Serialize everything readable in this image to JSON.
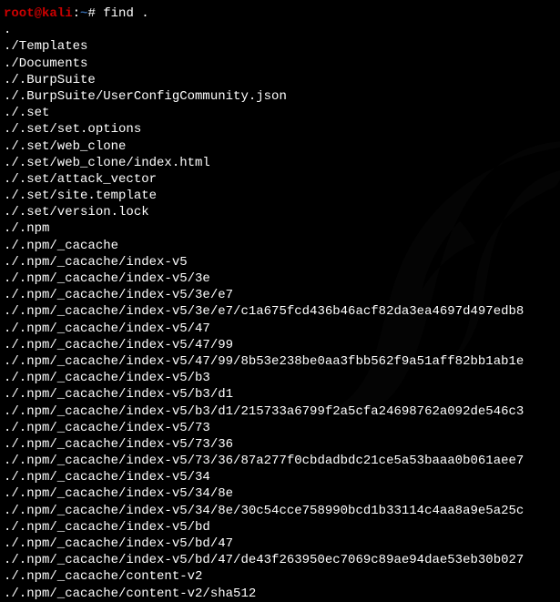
{
  "prompt": {
    "user": "root@kali",
    "separator": ":",
    "path": "~",
    "symbol": "#",
    "command": "find ."
  },
  "output": [
    ".",
    "./Templates",
    "./Documents",
    "./.BurpSuite",
    "./.BurpSuite/UserConfigCommunity.json",
    "./.set",
    "./.set/set.options",
    "./.set/web_clone",
    "./.set/web_clone/index.html",
    "./.set/attack_vector",
    "./.set/site.template",
    "./.set/version.lock",
    "./.npm",
    "./.npm/_cacache",
    "./.npm/_cacache/index-v5",
    "./.npm/_cacache/index-v5/3e",
    "./.npm/_cacache/index-v5/3e/e7",
    "./.npm/_cacache/index-v5/3e/e7/c1a675fcd436b46acf82da3ea4697d497edb8",
    "./.npm/_cacache/index-v5/47",
    "./.npm/_cacache/index-v5/47/99",
    "./.npm/_cacache/index-v5/47/99/8b53e238be0aa3fbb562f9a51aff82bb1ab1e",
    "./.npm/_cacache/index-v5/b3",
    "./.npm/_cacache/index-v5/b3/d1",
    "./.npm/_cacache/index-v5/b3/d1/215733a6799f2a5cfa24698762a092de546c3",
    "./.npm/_cacache/index-v5/73",
    "./.npm/_cacache/index-v5/73/36",
    "./.npm/_cacache/index-v5/73/36/87a277f0cbdadbdc21ce5a53baaa0b061aee7",
    "./.npm/_cacache/index-v5/34",
    "./.npm/_cacache/index-v5/34/8e",
    "./.npm/_cacache/index-v5/34/8e/30c54cce758990bcd1b33114c4aa8a9e5a25c",
    "./.npm/_cacache/index-v5/bd",
    "./.npm/_cacache/index-v5/bd/47",
    "./.npm/_cacache/index-v5/bd/47/de43f263950ec7069c89ae94dae53eb30b027",
    "./.npm/_cacache/content-v2",
    "./.npm/_cacache/content-v2/sha512"
  ]
}
